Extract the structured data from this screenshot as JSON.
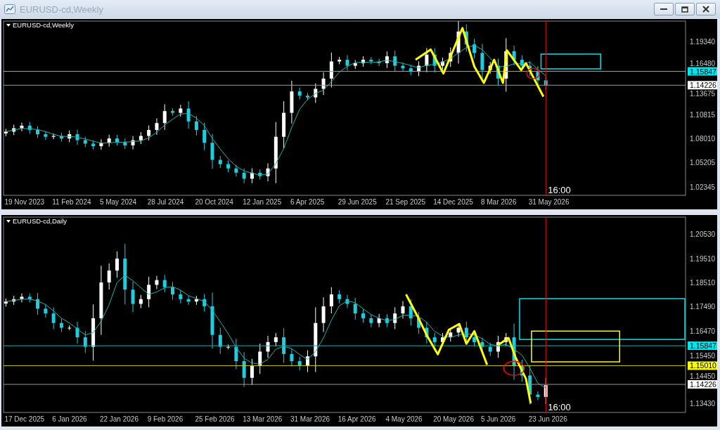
{
  "window": {
    "title": "EURUSD-cd,Weekly"
  },
  "window_buttons": [
    {
      "kind": "minimize"
    },
    {
      "kind": "maximize"
    },
    {
      "kind": "close"
    }
  ],
  "panels": [
    {
      "title": "EURUSD-cd,Weekly",
      "time_label": "16:00",
      "date_labels": [
        "19 Nov 2023",
        "11 Feb 2024",
        "5 May 2024",
        "28 Jul 2024",
        "20 Oct 2024",
        "12 Jan 2025",
        "6 Apr 2025",
        "29 Jun 2025",
        "21 Sep 2025",
        "14 Dec 2025",
        "8 Mar 2026",
        "31 May 2026"
      ],
      "price_labels": [
        "1.19340",
        "1.16480",
        "1.13675",
        "1.10815",
        "1.08010",
        "1.05205",
        "1.02345"
      ],
      "price_tags": [
        {
          "text": "1.15847",
          "color": "#00e5ee"
        },
        {
          "text": "1.14226",
          "color": "#ffffff"
        }
      ]
    },
    {
      "title": "EURUSD-cd,Daily",
      "time_label": "16:00",
      "date_labels": [
        "17 Dec 2025",
        "6 Jan 2026",
        "22 Jan 2026",
        "9 Feb 2026",
        "25 Feb 2026",
        "13 Mar 2026",
        "31 Mar 2026",
        "16 Apr 2026",
        "4 May 2026",
        "20 May 2026",
        "5 Jun 2026",
        "23 Jun 2026"
      ],
      "price_labels": [
        "1.20530",
        "1.19510",
        "1.18510",
        "1.17490",
        "1.16470",
        "1.15450",
        "1.14450",
        "1.13430"
      ],
      "price_tags": [
        {
          "text": "1.15847",
          "color": "#00e5ee"
        },
        {
          "text": "1.15010",
          "color": "#ffff00"
        },
        {
          "text": "1.14226",
          "color": "#ffffff"
        }
      ]
    }
  ]
}
